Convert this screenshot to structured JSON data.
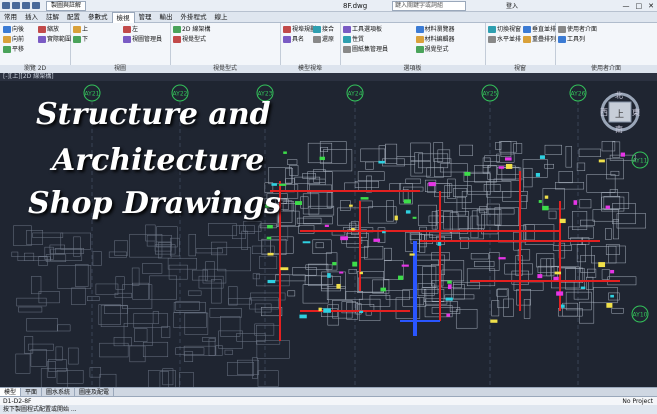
{
  "titlebar": {
    "workspace": "製圖與註解",
    "filename": "8F.dwg",
    "search_placeholder": "鍵入關鍵字或詞組",
    "login": "登入",
    "win_min": "—",
    "win_max": "□",
    "win_close": "✕"
  },
  "menu": {
    "tabs": [
      "常用",
      "插入",
      "註解",
      "配置",
      "參數式",
      "檢視",
      "管理",
      "輸出",
      "外掛程式",
      "線上"
    ],
    "active_index": 5
  },
  "ribbon": {
    "groups": [
      {
        "label": "瀏覽 2D",
        "buttons": [
          "向後",
          "向前",
          "平移",
          "縮放",
          "實際範圍"
        ]
      },
      {
        "label": "視圖",
        "buttons": [
          "上",
          "下",
          "左",
          "視圖管理員"
        ]
      },
      {
        "label": "視覺型式",
        "buttons": [
          "2D 線架構",
          "視覺型式"
        ]
      },
      {
        "label": "模型視埠",
        "buttons": [
          "視埠規劃",
          "具名",
          "接合",
          "還原"
        ]
      },
      {
        "label": "選項板",
        "buttons": [
          "工具選項板",
          "性質",
          "圖紙集管理員",
          "材料瀏覽器",
          "材料編輯器",
          "視覺型式"
        ]
      },
      {
        "label": "視窗",
        "buttons": [
          "切換視窗",
          "水平並排",
          "垂直並排",
          "重疊排列"
        ]
      },
      {
        "label": "使用者介面",
        "buttons": [
          "使用者介面",
          "工具列"
        ]
      }
    ]
  },
  "viewport_label": "[-][上][2D 線架構]",
  "overlay": {
    "line1": "Structure and",
    "line2": "Architecture",
    "line3": "Shop Drawings"
  },
  "grid_bubbles": [
    "AY21",
    "AY22",
    "AY23",
    "AY24",
    "AY25",
    "AY26",
    "AY11",
    "AY10"
  ],
  "viewcube": {
    "north": "北",
    "top": "上",
    "south": "南",
    "west": "西",
    "east": "東"
  },
  "layout_tabs": [
    "模型",
    "平面",
    "圖水系統",
    "圖座及配電"
  ],
  "command": {
    "text": "D1-D2-8F",
    "status": "No Project"
  },
  "statusbar": {
    "text": "按下製圖程式配置或開始 ..."
  },
  "colors": {
    "canvas_bg": "#1f2531",
    "grid_green": "#33c25a",
    "red": "#e32020",
    "blue": "#2a56ff"
  }
}
